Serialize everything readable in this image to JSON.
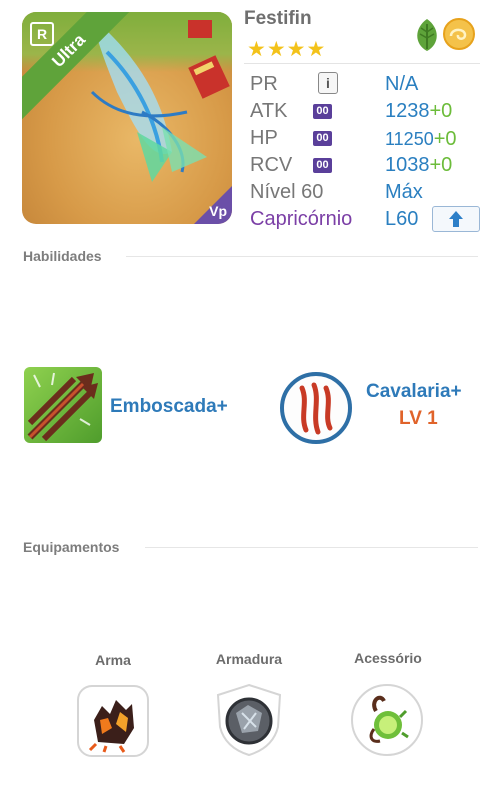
{
  "hero": {
    "name": "Festifin",
    "stars": "★★★★",
    "rarity_label": "Ultra",
    "rarity_badge": "R",
    "corner_badge": "Vp"
  },
  "stats": {
    "pr_label": "PR",
    "pr_info": "i",
    "pr_value": "N/A",
    "atk_label": "ATK",
    "atk_badge": "00",
    "atk_value": "1238",
    "atk_bonus": "+0",
    "hp_label": "HP",
    "hp_badge": "00",
    "hp_value": "11250",
    "hp_bonus": "+0",
    "rcv_label": "RCV",
    "rcv_badge": "00",
    "rcv_value": "1038",
    "rcv_bonus": "+0",
    "level_label": "Nível 60",
    "level_value": "Máx",
    "sign_label": "Capricórnio",
    "sign_level": "L60"
  },
  "skills": {
    "title": "Habilidades",
    "active_name": "Emboscada+",
    "leader_name": "Cavalaria+",
    "leader_level": "LV 1"
  },
  "equipment": {
    "title": "Equipamentos",
    "weapon_label": "Arma",
    "armor_label": "Armadura",
    "accessory_label": "Acessório"
  },
  "colors": {
    "value_blue": "#2a7fc0",
    "bonus_green": "#6cbc3a",
    "sign_purple": "#7b3fa6",
    "level_orange": "#e0632a",
    "rarity_green": "#5fa33a",
    "star_gold": "#f3c21a"
  },
  "icons": {
    "element": "leaf-icon",
    "subtype": "cloud-swirl-icon",
    "upgrade": "arrow-up-icon",
    "active_skill": "arrows-icon",
    "leader_skill": "claw-mark-icon",
    "weapon": "lava-claw-icon",
    "armor": "stone-shield-icon",
    "accessory": "green-orb-icon"
  }
}
